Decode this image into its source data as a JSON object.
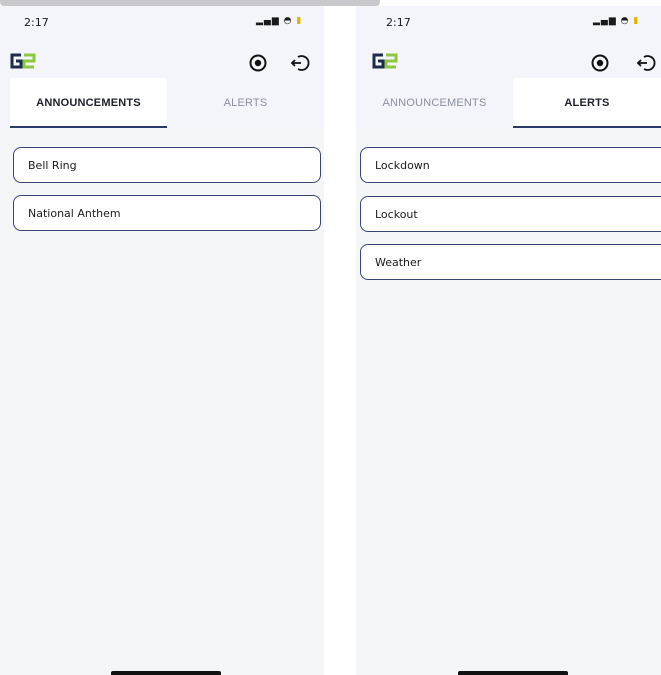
{
  "left": {
    "status": {
      "time": "2:17",
      "icons": "▂▄▆ ◓ "
    },
    "tabs": [
      {
        "label": "ANNOUNCEMENTS",
        "active": true
      },
      {
        "label": "ALERTS",
        "active": false
      }
    ],
    "items": [
      "Bell Ring",
      "National Anthem"
    ]
  },
  "right": {
    "status": {
      "time": "2:17",
      "icons": "▂▄▆ ◓ "
    },
    "tabs": [
      {
        "label": "ANNOUNCEMENTS",
        "active": false
      },
      {
        "label": "ALERTS",
        "active": true
      }
    ],
    "items": [
      "Lockdown",
      "Lockout",
      "Weather"
    ]
  },
  "colors": {
    "brand_dark": "#1e2a4a",
    "brand_green": "#8dc63f",
    "border": "#3a4470"
  },
  "icons": {
    "logo": "g2-logo",
    "record": "record-icon",
    "logout": "logout-icon"
  }
}
